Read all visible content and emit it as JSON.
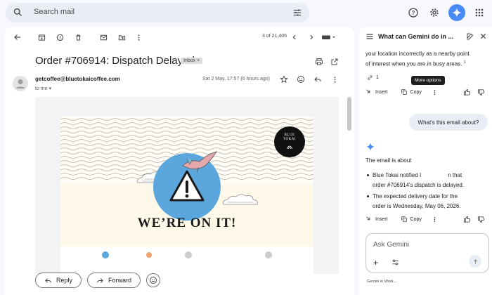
{
  "search": {
    "placeholder": "Search mail"
  },
  "toolbar": {
    "counter": "3 of 21,405"
  },
  "email": {
    "subject": "Order #706914: Dispatch Delayed",
    "label": "Inbox ×",
    "sender": "getcoffee@bluetokaicoffee.com",
    "recipient": "to me ▾",
    "date": "Sat 2 May, 17:57 (6 hours ago)",
    "headline": "WE’RE ON IT!",
    "logo_text": "BLUE TOKAI"
  },
  "actions": {
    "reply": "Reply",
    "forward": "Forward"
  },
  "gemini": {
    "title": "What can Gemini do in ...",
    "prev_line1": "your location incorrectly as a nearby point",
    "prev_line2": "of interest when you are in busy areas.",
    "prev_footnote": "1",
    "source_count": "1",
    "insert": "Insert",
    "copy": "Copy",
    "tooltip": "More options",
    "user_message": "What's this email about?",
    "answer_intro": "The email is about",
    "bullet1_a": "Blue Tokai notified I",
    "bullet1_b": "n that",
    "bullet1_c": "order #706914's dispatch is delayed.",
    "bullet2_a": "The expected delivery date for the",
    "bullet2_b": "order is Wednesday, May 06, 2026.",
    "ask_placeholder": "Ask Gemini",
    "footer": "Gemini in Work..."
  },
  "colors": {
    "accent": "#0b57d0",
    "gemini_blue": "#4a8cf7",
    "panel_bg": "#f6f8fc",
    "circle_blue": "#5aa6dd"
  }
}
